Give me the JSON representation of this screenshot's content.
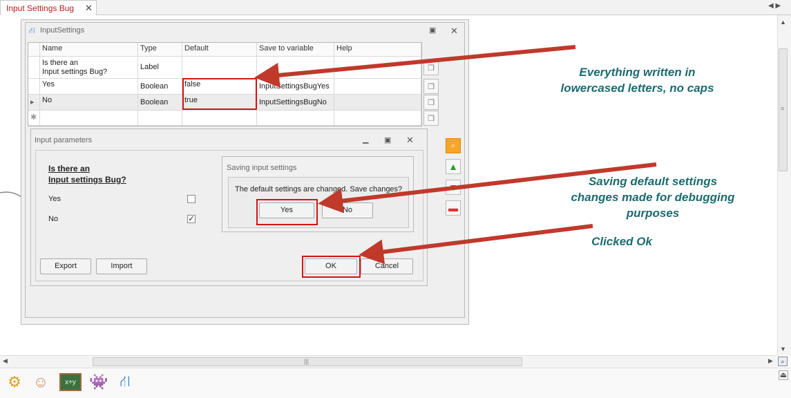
{
  "tab": {
    "title": "Input Settings Bug",
    "close": "✕"
  },
  "nav": {
    "arrows": "◀ ▶"
  },
  "input_settings": {
    "title": "InputSettings",
    "columns": [
      "Name",
      "Type",
      "Default",
      "Save to variable",
      "Help"
    ],
    "rows": [
      {
        "name": "Is there an\nInput settings Bug?",
        "type": "Label",
        "default": "",
        "save": "",
        "help": ""
      },
      {
        "name": "Yes",
        "type": "Boolean",
        "default": "false",
        "save": "InputSettingsBugYes",
        "help": ""
      },
      {
        "name": "No",
        "type": "Boolean",
        "default": "true",
        "save": "InputSettingsBugNo",
        "help": ""
      }
    ],
    "new_row_marker": "✱",
    "current_row_marker": "▸"
  },
  "input_params": {
    "title": "Input parameters",
    "question": "Is there an\nInput settings Bug?",
    "options": [
      {
        "label": "Yes",
        "checked": false
      },
      {
        "label": "No",
        "checked": true
      }
    ],
    "export": "Export",
    "import": "Import",
    "ok": "OK",
    "cancel": "Cancel"
  },
  "saving": {
    "title": "Saving input settings",
    "message": "The default settings are changed. Save changes?",
    "yes": "Yes",
    "no": "No"
  },
  "annotations": [
    "Everything written in\nlowercased letters, no caps",
    "Saving default settings\nchanges made for debugging\npurposes",
    "Clicked Ok"
  ],
  "colors": {
    "tab_text": "#b22222",
    "annotation": "#1b6b6f",
    "arrow": "#c0392b",
    "highlight": "#d21414"
  }
}
